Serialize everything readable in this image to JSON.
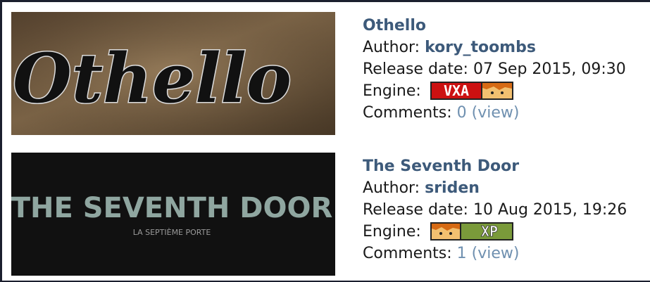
{
  "games": [
    {
      "title": "Othello",
      "author_label": "Author:",
      "author": "kory_toombs",
      "release_label": "Release date:",
      "release_date": "07 Sep 2015, 09:30",
      "engine_label": "Engine:",
      "engine_badge": "VXA",
      "comments_label": "Comments:",
      "comments_count": "0",
      "view_label": "(view)",
      "banner_text": "Othello"
    },
    {
      "title": "The Seventh Door",
      "author_label": "Author:",
      "author": "sriden",
      "release_label": "Release date:",
      "release_date": "10 Aug 2015, 19:26",
      "engine_label": "Engine:",
      "engine_badge": "XP",
      "comments_label": "Comments:",
      "comments_count": "1",
      "view_label": "(view)",
      "banner_text": "THE SEVENTH DOOR",
      "banner_subtitle": "LA SEPTIÈME PORTE"
    }
  ],
  "colors": {
    "link": "#3d5a7a",
    "muted_link": "#6f90b0",
    "vxa_badge_bg": "#cc1111",
    "xp_badge_bg": "#7a9a3a"
  }
}
